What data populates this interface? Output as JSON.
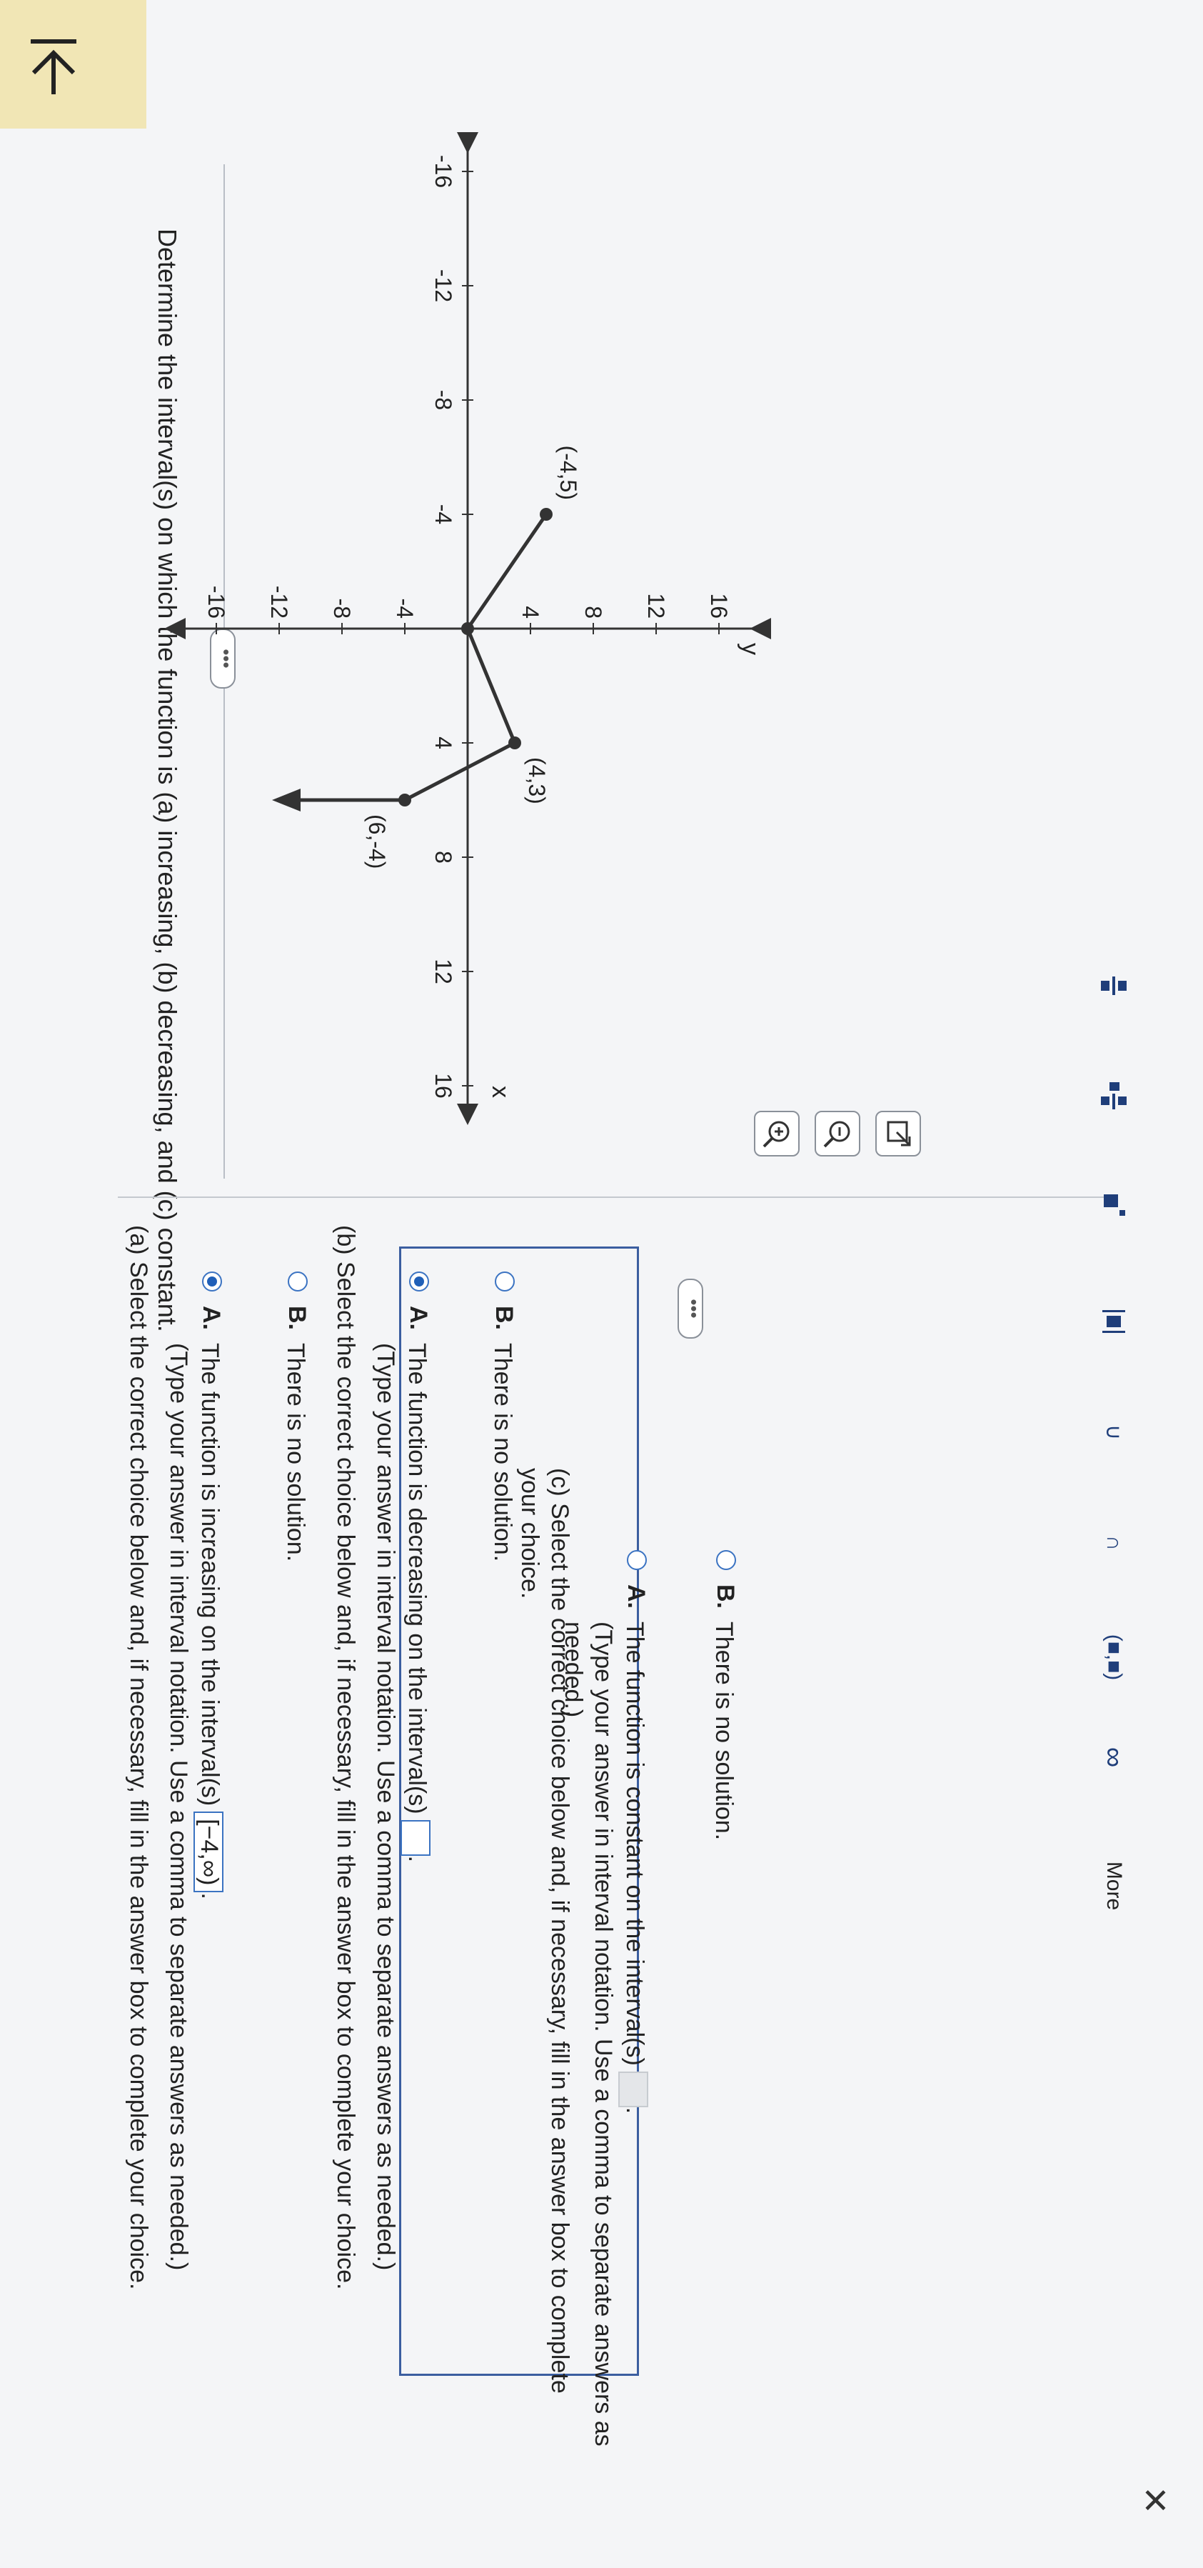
{
  "question": "Determine the interval(s) on which the function is (a) increasing, (b) decreasing, and (c) constant.",
  "graph": {
    "x_axis_label": "x",
    "y_axis_label": "y",
    "x_ticks": [
      "-16",
      "-12",
      "-8",
      "-4",
      "4",
      "8",
      "12",
      "16"
    ],
    "y_ticks": [
      "16",
      "12",
      "8",
      "4",
      "-4",
      "-8",
      "-12",
      "-16"
    ],
    "points": [
      {
        "label": "(-4,5)",
        "x": -4,
        "y": 5
      },
      {
        "label": "",
        "x": 0,
        "y": 0
      },
      {
        "label": "(4,3)",
        "x": 4,
        "y": 3
      },
      {
        "label": "(6,-4)",
        "x": 6,
        "y": -4
      }
    ],
    "end_arrow": {
      "x": 6,
      "y": -12
    }
  },
  "part_a": {
    "prompt": "(a) Select the correct choice below and, if necessary, fill in the answer box to complete your choice.",
    "option_a": {
      "letter": "A.",
      "text": "The function is increasing on the interval(s)",
      "answer": "[−4,∞)",
      "note": "(Type your answer in interval notation. Use a comma to separate answers as needed.)",
      "selected": true
    },
    "option_b": {
      "letter": "B.",
      "text": "There is no solution.",
      "selected": false
    }
  },
  "part_b": {
    "prompt": "(b) Select the correct choice below and, if necessary, fill in the answer box to complete your choice.",
    "option_a": {
      "letter": "A.",
      "text": "The function is decreasing on the interval(s)",
      "answer": "",
      "note": "(Type your answer in interval notation. Use a comma to separate answers as needed.)",
      "selected": true
    },
    "option_b": {
      "letter": "B.",
      "text": "There is no solution.",
      "selected": false
    }
  },
  "part_c": {
    "prompt": "(c) Select the correct choice below and, if necessary, fill in the answer box to complete your choice.",
    "option_a": {
      "letter": "A.",
      "text": "The function is constant on the interval(s)",
      "answer": "",
      "note": "(Type your answer in interval notation. Use a comma to separate answers as needed.)",
      "selected": false
    },
    "option_b": {
      "letter": "B.",
      "text": "There is no solution.",
      "selected": false
    }
  },
  "toolbar": {
    "more_label": "More",
    "infinity": "∞",
    "interval": "(■,■)",
    "union": "∪",
    "intersection": "∩"
  },
  "dots": "•••",
  "close": "✕"
}
